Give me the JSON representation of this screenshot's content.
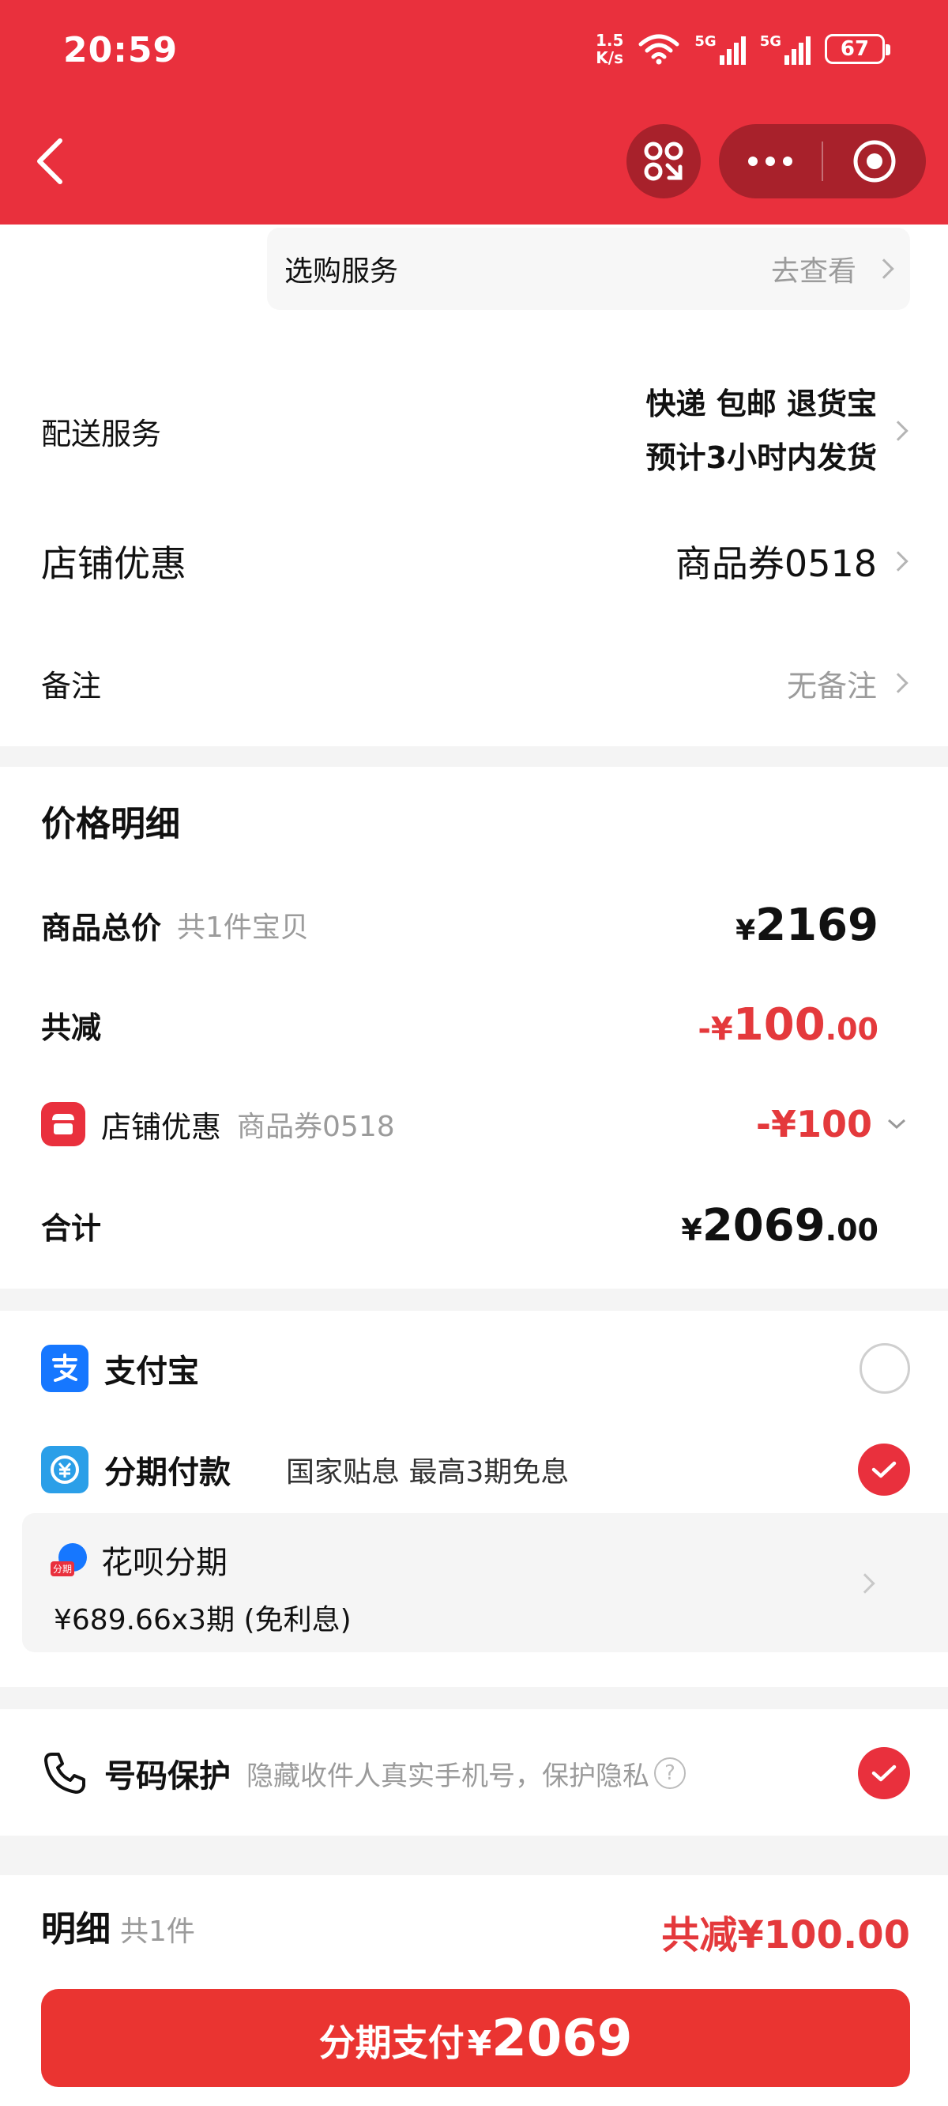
{
  "status_bar": {
    "time": "20:59",
    "net_speed_top": "1.5",
    "net_speed_bottom": "K/s",
    "sig1_label": "5G",
    "sig2_label": "5G",
    "battery": "67"
  },
  "colors": {
    "brand_red": "#e9303d",
    "alipay_blue": "#1677ff",
    "price_red": "#e4393c"
  },
  "services": {
    "shopping_service_label": "选购服务",
    "shopping_service_action": "去查看",
    "delivery_label": "配送服务",
    "delivery_line1": "快递 包邮 退货宝",
    "delivery_line2": "预计3小时内发货",
    "shop_discount_label": "店铺优惠",
    "shop_discount_value": "商品券0518",
    "remark_label": "备注",
    "remark_value": "无备注"
  },
  "price_detail": {
    "title": "价格明细",
    "goods_total_label": "商品总价",
    "goods_total_count": "共1件宝贝",
    "goods_total_currency": "¥",
    "goods_total_value": "2169",
    "reduction_label": "共减",
    "reduction_prefix": "-¥",
    "reduction_int": "100",
    "reduction_dec": ".00",
    "shop_discount_label": "店铺优惠",
    "shop_discount_coupon": "商品券0518",
    "shop_discount_amount": "-¥100",
    "total_label": "合计",
    "total_currency": "¥",
    "total_int": "2069",
    "total_dec": ".00"
  },
  "payment": {
    "alipay_label": "支付宝",
    "installment_label": "分期付款",
    "installment_note": "国家贴息 最高3期免息",
    "huabei_badge": "分期",
    "huabei_title": "花呗分期",
    "huabei_detail": "¥689.66x3期 (免利息)"
  },
  "privacy": {
    "label": "号码保护",
    "desc": "隐藏收件人真实手机号，保护隐私",
    "help": "?"
  },
  "bottom": {
    "detail_label": "明细",
    "detail_count": "共1件",
    "total_reduction": "共减¥100.00",
    "pay_button_label": "分期支付",
    "pay_button_currency": "¥",
    "pay_button_amount": "2069"
  }
}
